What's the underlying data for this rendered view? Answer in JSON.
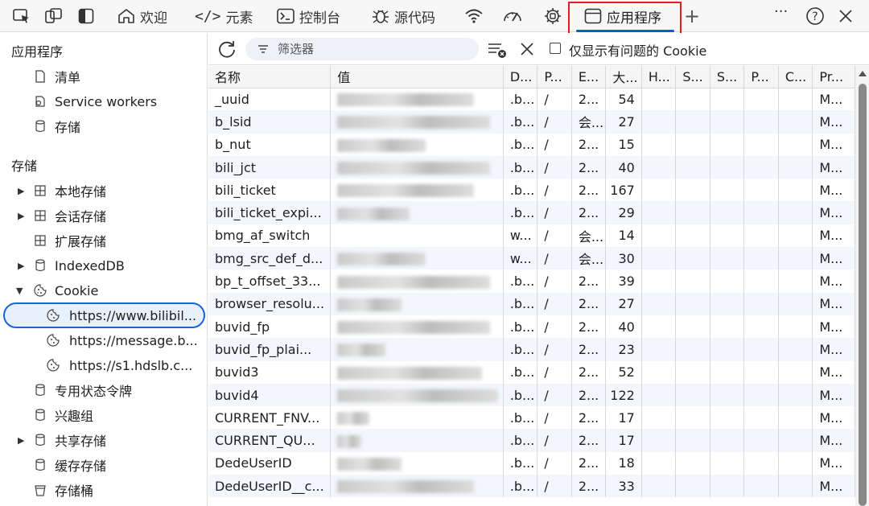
{
  "topbar": {
    "tabs": [
      {
        "label": "欢迎",
        "icon": "home-icon"
      },
      {
        "label": "元素",
        "icon": "code-tag-icon"
      },
      {
        "label": "控制台",
        "icon": "terminal-icon"
      },
      {
        "label": "源代码",
        "icon": "bug-icon"
      },
      {
        "label": "",
        "icon": "wifi-icon"
      },
      {
        "label": "",
        "icon": "performance-gauge-icon"
      },
      {
        "label": "",
        "icon": "gear-chip-icon"
      },
      {
        "label": "应用程序",
        "icon": "window-icon"
      }
    ],
    "add_tab": "+",
    "more": "···",
    "help": "?",
    "close": "✕"
  },
  "sidebar": {
    "app_heading": "应用程序",
    "app_items": [
      {
        "label": "清单",
        "icon": "file-icon"
      },
      {
        "label": "Service workers",
        "icon": "gear-icon"
      },
      {
        "label": "存储",
        "icon": "cylinder-icon"
      }
    ],
    "storage_heading": "存储",
    "storage_items": [
      {
        "label": "本地存储",
        "icon": "grid-icon",
        "expandable": true
      },
      {
        "label": "会话存储",
        "icon": "grid-icon",
        "expandable": true
      },
      {
        "label": "扩展存储",
        "icon": "grid-icon",
        "expandable": false
      },
      {
        "label": "IndexedDB",
        "icon": "cylinder-icon",
        "expandable": true
      },
      {
        "label": "Cookie",
        "icon": "cookie-icon",
        "expanded": true
      }
    ],
    "cookie_sites": [
      {
        "label": "https://www.bilibil...",
        "selected": true
      },
      {
        "label": "https://message.b..."
      },
      {
        "label": "https://s1.hdslb.c..."
      }
    ],
    "more_items": [
      {
        "label": "专用状态令牌",
        "icon": "cylinder-icon",
        "expandable": false
      },
      {
        "label": "兴趣组",
        "icon": "cylinder-icon",
        "expandable": false
      },
      {
        "label": "共享存储",
        "icon": "cylinder-icon",
        "expandable": true
      },
      {
        "label": "缓存存储",
        "icon": "cylinder-icon",
        "expandable": false
      },
      {
        "label": "存储桶",
        "icon": "bucket-icon",
        "expandable": false
      }
    ]
  },
  "toolbar": {
    "filter_placeholder": "筛选器",
    "only_issues_label": "仅显示有问题的 Cookie"
  },
  "table": {
    "headers": [
      "名称",
      "值",
      "D...",
      "P...",
      "E...",
      "大...",
      "H...",
      "S...",
      "S...",
      "P...",
      "C...",
      "Pr..."
    ],
    "rows": [
      {
        "name": "_uuid",
        "domain": ".b...",
        "path": "/",
        "expires": "2...",
        "size": "54",
        "priority": "M..."
      },
      {
        "name": "b_lsid",
        "domain": ".b...",
        "path": "/",
        "expires": "会...",
        "size": "27",
        "priority": "M..."
      },
      {
        "name": "b_nut",
        "domain": ".b...",
        "path": "/",
        "expires": "2...",
        "size": "15",
        "priority": "M..."
      },
      {
        "name": "bili_jct",
        "domain": ".b...",
        "path": "/",
        "expires": "2...",
        "size": "40",
        "priority": "M..."
      },
      {
        "name": "bili_ticket",
        "domain": ".b...",
        "path": "/",
        "expires": "2...",
        "size": "167",
        "priority": "M..."
      },
      {
        "name": "bili_ticket_expi...",
        "domain": ".b...",
        "path": "/",
        "expires": "2...",
        "size": "29",
        "priority": "M..."
      },
      {
        "name": "bmg_af_switch",
        "domain": "w...",
        "path": "/",
        "expires": "会...",
        "size": "14",
        "priority": "M..."
      },
      {
        "name": "bmg_src_def_d...",
        "domain": "w...",
        "path": "/",
        "expires": "会...",
        "size": "30",
        "priority": "M..."
      },
      {
        "name": "bp_t_offset_33...",
        "domain": ".b...",
        "path": "/",
        "expires": "2...",
        "size": "39",
        "priority": "M..."
      },
      {
        "name": "browser_resolu...",
        "domain": ".b...",
        "path": "/",
        "expires": "2...",
        "size": "27",
        "priority": "M..."
      },
      {
        "name": "buvid_fp",
        "domain": ".b...",
        "path": "/",
        "expires": "2...",
        "size": "40",
        "priority": "M..."
      },
      {
        "name": "buvid_fp_plai...",
        "domain": ".b...",
        "path": "/",
        "expires": "2...",
        "size": "23",
        "priority": "M..."
      },
      {
        "name": "buvid3",
        "domain": ".b...",
        "path": "/",
        "expires": "2...",
        "size": "52",
        "priority": "M..."
      },
      {
        "name": "buvid4",
        "domain": ".b...",
        "path": "/",
        "expires": "2...",
        "size": "122",
        "priority": "M..."
      },
      {
        "name": "CURRENT_FNV...",
        "domain": ".b...",
        "path": "/",
        "expires": "2...",
        "size": "17",
        "priority": "M..."
      },
      {
        "name": "CURRENT_QU...",
        "domain": ".b...",
        "path": "/",
        "expires": "2...",
        "size": "17",
        "priority": "M..."
      },
      {
        "name": "DedeUserID",
        "domain": ".b...",
        "path": "/",
        "expires": "2...",
        "size": "18",
        "priority": "M..."
      },
      {
        "name": "DedeUserID__c...",
        "domain": ".b...",
        "path": "/",
        "expires": "2...",
        "size": "33",
        "priority": "M..."
      }
    ]
  }
}
